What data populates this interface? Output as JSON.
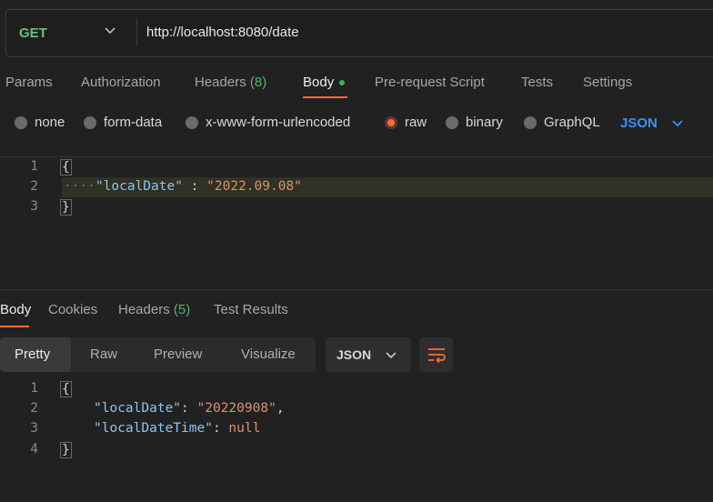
{
  "request": {
    "method": "GET",
    "url": "http://localhost:8080/date"
  },
  "request_tabs": [
    {
      "label": "Params"
    },
    {
      "label": "Authorization"
    },
    {
      "label": "Headers",
      "count": "(8)"
    },
    {
      "label": "Body"
    },
    {
      "label": "Pre-request Script"
    },
    {
      "label": "Tests"
    },
    {
      "label": "Settings"
    }
  ],
  "body_types": [
    {
      "label": "none",
      "selected": false
    },
    {
      "label": "form-data",
      "selected": false
    },
    {
      "label": "x-www-form-urlencoded",
      "selected": false
    },
    {
      "label": "raw",
      "selected": true
    },
    {
      "label": "binary",
      "selected": false
    },
    {
      "label": "GraphQL",
      "selected": false
    }
  ],
  "body_format": "JSON",
  "request_body": {
    "line_numbers": [
      "1",
      "2",
      "3"
    ],
    "open_brace": "{",
    "indent": "····",
    "key": "\"localDate\"",
    "colon": " : ",
    "value": "\"2022.09.08\"",
    "close_brace": "}"
  },
  "response_tabs": [
    {
      "label": "Body"
    },
    {
      "label": "Cookies"
    },
    {
      "label": "Headers",
      "count": "(5)"
    },
    {
      "label": "Test Results"
    }
  ],
  "view_modes": [
    "Pretty",
    "Raw",
    "Preview",
    "Visualize"
  ],
  "response_format": "JSON",
  "response_body": {
    "line_numbers": [
      "1",
      "2",
      "3",
      "4"
    ],
    "open_brace": "{",
    "key1": "\"localDate\"",
    "colon1": ": ",
    "value1": "\"20220908\"",
    "comma1": ",",
    "key2": "\"localDateTime\"",
    "colon2": ": ",
    "value2": "null",
    "close_brace": "}"
  },
  "colors": {
    "accent": "#ff6c37",
    "method_get": "#6cc081",
    "json_link": "#3b92f5",
    "count_green": "#53b66c"
  }
}
